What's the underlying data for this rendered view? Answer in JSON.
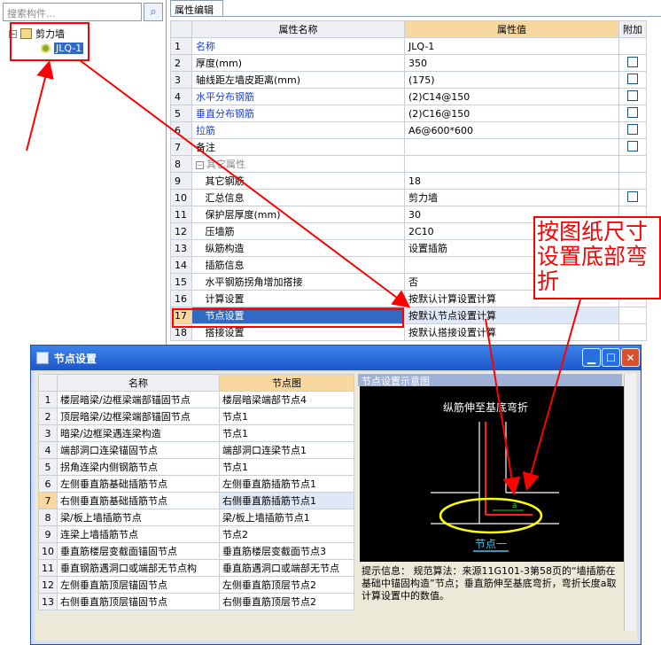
{
  "left": {
    "search_placeholder": "搜索构件...",
    "tree": [
      {
        "label": "剪力墙",
        "expander": "⊟"
      },
      {
        "label": "JLQ-1"
      }
    ]
  },
  "props": {
    "tab": "属性编辑",
    "headers": {
      "name": "属性名称",
      "value": "属性值",
      "attach": "附加"
    },
    "rows": [
      {
        "num": "1",
        "name": "名称",
        "value": "JLQ-1",
        "blue": true,
        "check": false
      },
      {
        "num": "2",
        "name": "厚度(mm)",
        "value": "350",
        "check": true
      },
      {
        "num": "3",
        "name": "轴线距左墙皮距离(mm)",
        "value": "(175)",
        "check": true
      },
      {
        "num": "4",
        "name": "水平分布钢筋",
        "value": "(2)C14@150",
        "blue": true,
        "check": true
      },
      {
        "num": "5",
        "name": "垂直分布钢筋",
        "value": "(2)C16@150",
        "blue": true,
        "check": true
      },
      {
        "num": "6",
        "name": "拉筋",
        "value": "A6@600*600",
        "blue": true,
        "check": true
      },
      {
        "num": "7",
        "name": "备注",
        "value": "",
        "check": true
      },
      {
        "num": "8",
        "name": "其它属性",
        "value": "",
        "group": true
      },
      {
        "num": "9",
        "name": "其它钢筋",
        "value": "18"
      },
      {
        "num": "10",
        "name": "汇总信息",
        "value": "剪力墙",
        "check": true
      },
      {
        "num": "11",
        "name": "保护层厚度(mm)",
        "value": "30"
      },
      {
        "num": "12",
        "name": "压墙筋",
        "value": "2C10"
      },
      {
        "num": "13",
        "name": "纵筋构造",
        "value": "设置插筋"
      },
      {
        "num": "14",
        "name": "插筋信息",
        "value": ""
      },
      {
        "num": "15",
        "name": "水平钢筋拐角增加搭接",
        "value": "否"
      },
      {
        "num": "16",
        "name": "计算设置",
        "value": "按默认计算设置计算"
      },
      {
        "num": "17",
        "name": "节点设置",
        "value": "按默认节点设置计算",
        "selected": true
      },
      {
        "num": "18",
        "name": "搭接设置",
        "value": "按默认搭接设置计算"
      }
    ]
  },
  "dialog": {
    "title": "节点设置",
    "headers": {
      "name": "名称",
      "node": "节点图"
    },
    "rows": [
      {
        "num": "1",
        "name": "楼层暗梁/边框梁端部锚固节点",
        "node": "楼层暗梁端部节点4"
      },
      {
        "num": "2",
        "name": "顶层暗梁/边框梁端部锚固节点",
        "node": "节点1"
      },
      {
        "num": "3",
        "name": "暗梁/边框梁遇连梁构造",
        "node": "节点1"
      },
      {
        "num": "4",
        "name": "端部洞口连梁锚固节点",
        "node": "端部洞口连梁节点1"
      },
      {
        "num": "5",
        "name": "拐角连梁内侧钢筋节点",
        "node": "节点1"
      },
      {
        "num": "6",
        "name": "左侧垂直筋基础插筋节点",
        "node": "左侧垂直筋插筋节点1"
      },
      {
        "num": "7",
        "name": "右侧垂直筋基础插筋节点",
        "node": "右侧垂直筋插筋节点1",
        "selected": true
      },
      {
        "num": "8",
        "name": "梁/板上墙插筋节点",
        "node": "梁/板上墙插筋节点1"
      },
      {
        "num": "9",
        "name": "连梁上墙插筋节点",
        "node": "节点2"
      },
      {
        "num": "10",
        "name": "垂直筋楼层变截面锚固节点",
        "node": "垂直筋楼层变截面节点3"
      },
      {
        "num": "11",
        "name": "垂直钢筋遇洞口或端部无节点构",
        "node": "垂直筋遇洞口或端部无节点"
      },
      {
        "num": "12",
        "name": "左侧垂直筋顶层锚固节点",
        "node": "左侧垂直筋顶层节点2"
      },
      {
        "num": "13",
        "name": "右侧垂直筋顶层锚固节点",
        "node": "右侧垂直筋顶层节点2"
      }
    ],
    "preview_title": "节点设置示意图",
    "preview_caption": "纵筋伸至基底弯折",
    "preview_dim": "a",
    "preview_node": "节点一",
    "hint_label": "提示信息：",
    "hint_text": "规范算法：来源11G101-3第58页的“墙插筋在基础中锚固构造”节点；垂直筋伸至基底弯折，弯折长度a取计算设置中的数值。"
  },
  "annotation": {
    "text": "按图纸尺寸设置底部弯折",
    "color": "#ff0000"
  },
  "colors": {
    "selection": "#316ac5",
    "highlight": "#f8d7a0",
    "title_bar": "#1c56c9",
    "annotation": "#ff0000",
    "ellipse": "#ffff00"
  }
}
